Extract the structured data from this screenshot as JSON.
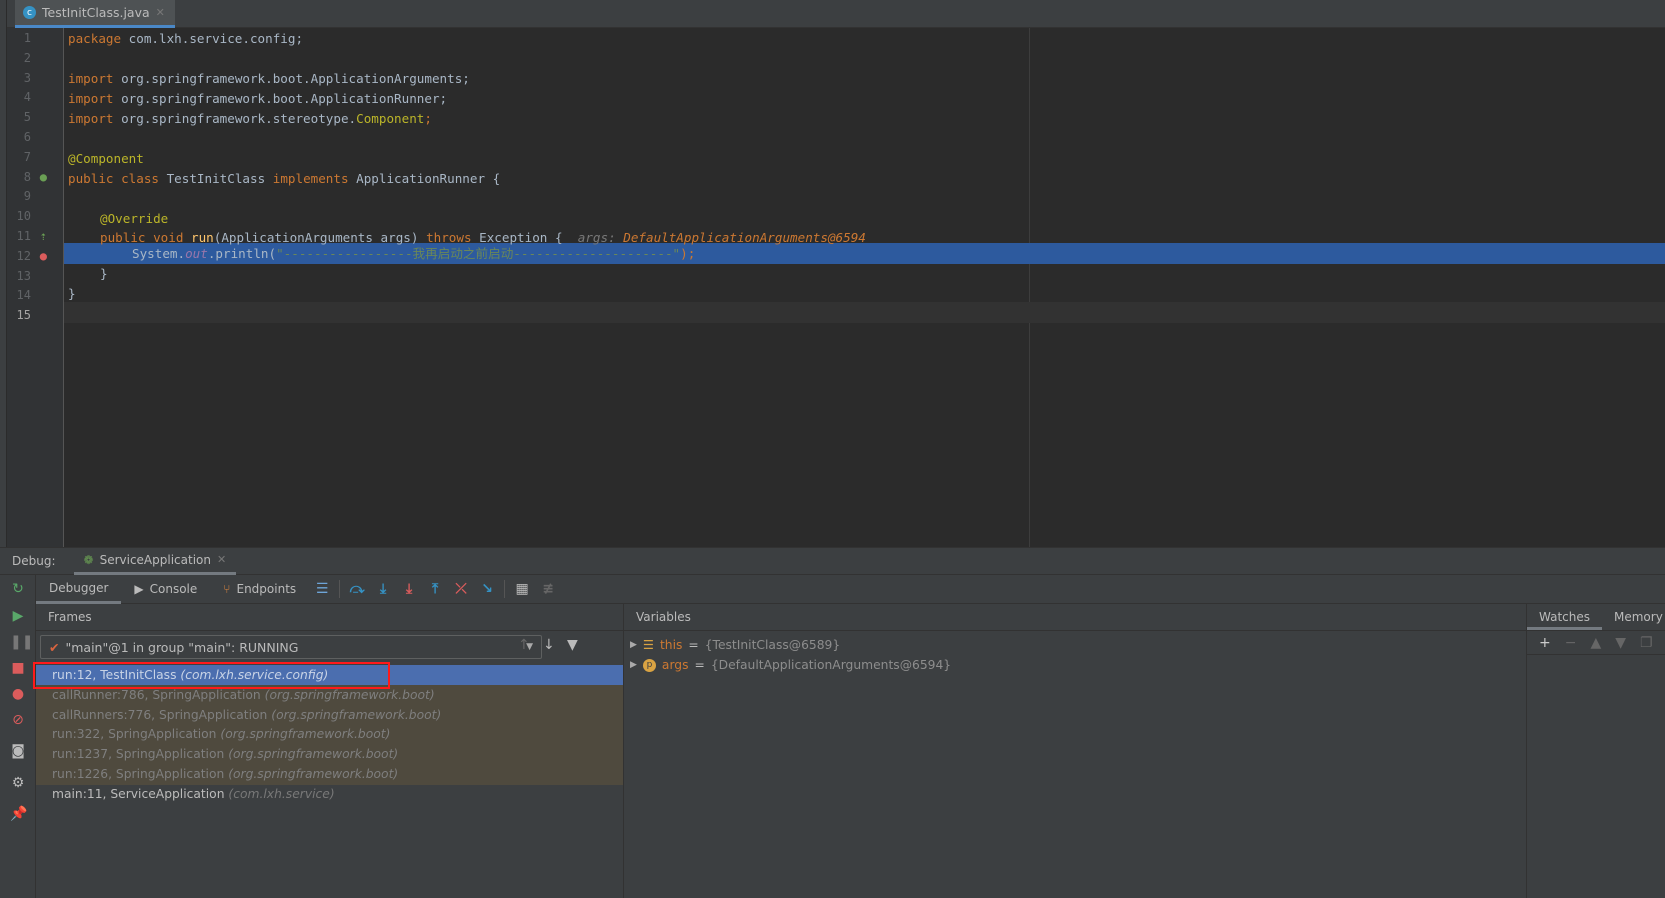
{
  "editor": {
    "tab": {
      "label": "TestInitClass.java",
      "icon": "java-class-icon"
    },
    "lines": [
      "1",
      "2",
      "3",
      "4",
      "5",
      "6",
      "7",
      "8",
      "9",
      "10",
      "11",
      "12",
      "13",
      "14",
      "15"
    ],
    "code": {
      "l1": [
        "package",
        " com.lxh.service.config;"
      ],
      "l3": [
        "import",
        " org.springframework.boot.ApplicationArguments;"
      ],
      "l4": [
        "import",
        " org.springframework.boot.ApplicationRunner;"
      ],
      "l5": [
        "import",
        " org.springframework.stereotype.",
        "Component",
        ";"
      ],
      "l7": "@Component",
      "l8": [
        "public class",
        " TestInitClass ",
        "implements",
        " ApplicationRunner {"
      ],
      "l10": "@Override",
      "l11": [
        "public void ",
        "run",
        "(ApplicationArguments args) ",
        "throws",
        " Exception {",
        "args: ",
        "DefaultApplicationArguments@6594"
      ],
      "l12": [
        "System.",
        "out",
        ".println(",
        "\"-----------------我再启动之前启动---------------------\"",
        ");"
      ],
      "l13": "}",
      "l14": "}"
    },
    "highlight_color": "#2d5a9e"
  },
  "debug": {
    "label": "Debug:",
    "session": "ServiceApplication",
    "tabs": [
      "Debugger",
      "Console",
      "Endpoints"
    ],
    "frames_header": "Frames",
    "variables_header": "Variables",
    "thread": "\"main\"@1 in group \"main\": RUNNING",
    "frames": [
      {
        "method": "run:12, TestInitClass",
        "pkg": "(com.lxh.service.config)",
        "state": "selected"
      },
      {
        "method": "callRunner:786, SpringApplication",
        "pkg": "(org.springframework.boot)",
        "state": "library"
      },
      {
        "method": "callRunners:776, SpringApplication",
        "pkg": "(org.springframework.boot)",
        "state": "library"
      },
      {
        "method": "run:322, SpringApplication",
        "pkg": "(org.springframework.boot)",
        "state": "library"
      },
      {
        "method": "run:1237, SpringApplication",
        "pkg": "(org.springframework.boot)",
        "state": "library"
      },
      {
        "method": "run:1226, SpringApplication",
        "pkg": "(org.springframework.boot)",
        "state": "library"
      },
      {
        "method": "main:11, ServiceApplication",
        "pkg": "(com.lxh.service)",
        "state": "normal"
      }
    ],
    "variables": [
      {
        "name": "this",
        "value": "{TestInitClass@6589}"
      },
      {
        "name": "args",
        "value": "{DefaultApplicationArguments@6594}"
      }
    ],
    "watch_tabs": [
      "Watches",
      "Memory"
    ]
  }
}
